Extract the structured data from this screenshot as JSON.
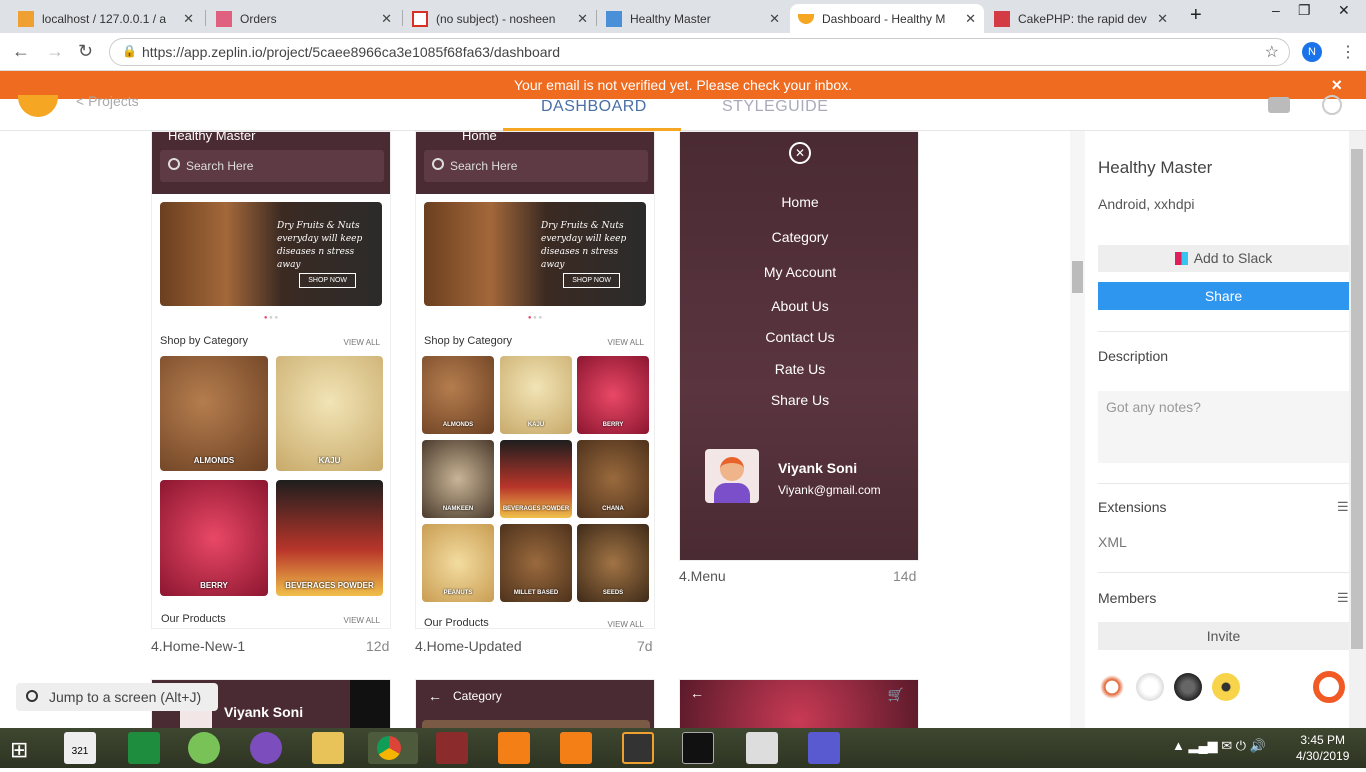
{
  "browser": {
    "tabs": [
      {
        "title": "localhost / 127.0.0.1 / a"
      },
      {
        "title": "Orders"
      },
      {
        "title": "(no subject) - nosheen"
      },
      {
        "title": "Healthy Master"
      },
      {
        "title": "Dashboard - Healthy M"
      },
      {
        "title": "CakePHP: the rapid dev"
      }
    ],
    "new_tab": "+",
    "url": "https://app.zeplin.io/project/5caee8966ca3e1085f68fa63/dashboard",
    "profile_initial": "N"
  },
  "banner": {
    "text": "Your email is not verified yet. Please check your inbox.",
    "close": "×"
  },
  "header": {
    "projects": "< Projects",
    "tabs": [
      "DASHBOARD",
      "STYLEGUIDE"
    ]
  },
  "screens": {
    "home_new": {
      "title": "Healthy Master",
      "search": "Search Here",
      "hero_text": "Dry Fruits & Nuts everyday will keep diseases n stress away",
      "hero_button": "SHOP NOW",
      "shop_by": "Shop by Category",
      "view_all": "VIEW ALL",
      "tiles": [
        "ALMONDS",
        "KAJU",
        "BERRY",
        "BEVERAGES POWDER"
      ],
      "our_products": "Our Products",
      "caption": "4.Home-New-1",
      "age": "12d"
    },
    "home_updated": {
      "title": "Home",
      "search": "Search Here",
      "hero_text": "Dry Fruits & Nuts everyday will keep diseases n stress away",
      "hero_button": "SHOP NOW",
      "shop_by": "Shop by Category",
      "view_all": "VIEW ALL",
      "tiles": [
        "ALMONDS",
        "KAJU",
        "BERRY",
        "NAMKEEN",
        "BEVERAGES POWDER",
        "CHANA",
        "PEANUTS",
        "MILLET BASED",
        "SEEDS"
      ],
      "our_products": "Our Products",
      "caption": "4.Home-Updated",
      "age": "7d"
    },
    "menu": {
      "items": [
        "Home",
        "Category",
        "My Account",
        "About Us",
        "Contact Us",
        "Rate Us",
        "Share Us"
      ],
      "user_name": "Viyank Soni",
      "user_email": "Viyank@gmail.com",
      "caption": "4.Menu",
      "age": "14d"
    },
    "bottom": {
      "profile_name": "Viyank Soni",
      "category_title": "Category"
    }
  },
  "jump": {
    "placeholder": "Jump to a screen (Alt+J)"
  },
  "panel": {
    "title": "Healthy Master",
    "subtitle": "Android, xxhdpi",
    "slack": "Add to Slack",
    "share": "Share",
    "description": "Description",
    "notes_placeholder": "Got any notes?",
    "extensions": "Extensions",
    "extension_item": "XML",
    "members": "Members",
    "invite": "Invite"
  },
  "taskbar": {
    "time": "3:45 PM",
    "date": "4/30/2019",
    "calendar_badge": "321"
  }
}
